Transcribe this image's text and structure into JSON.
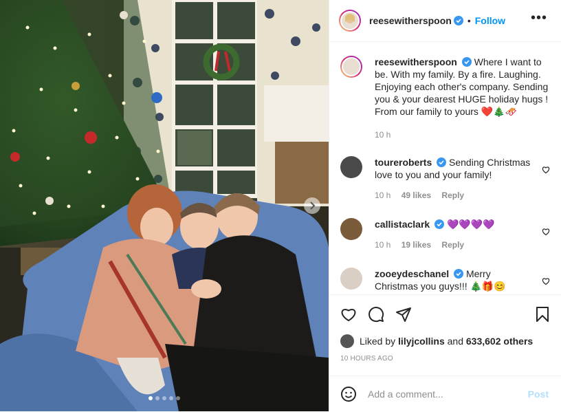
{
  "post": {
    "username": "reesewitherspoon",
    "follow_label": "Follow",
    "separator": "•",
    "more_label": "•••",
    "caption": "Where I want to be. With my family. By a fire. Laughing. Enjoying each other's company. Sending you & your dearest HUGE holiday hugs ! From our family to yours ❤️🎄🛷",
    "caption_time": "10 h"
  },
  "comments": [
    {
      "username": "toureroberts",
      "text": "Sending Christmas love to you and your family!",
      "time": "10 h",
      "likes": "49 likes",
      "reply": "Reply"
    },
    {
      "username": "callistaclark",
      "text": "💜💜💜💜",
      "time": "10 h",
      "likes": "19 likes",
      "reply": "Reply"
    },
    {
      "username": "zooeydeschanel",
      "text": "Merry Christmas you guys!!! 🎄🎁😊"
    }
  ],
  "likes": {
    "prefix": "Liked by",
    "user": "lilyjcollins",
    "connector": "and",
    "count": "633,602 others"
  },
  "timestamp": "10 HOURS AGO",
  "add_comment": {
    "placeholder": "Add a comment...",
    "post_label": "Post"
  },
  "carousel": {
    "total": 5,
    "current": 1
  },
  "colors": {
    "accent": "#0095f6",
    "text": "#262626",
    "muted": "#8e8e8e",
    "post_disabled": "#b2dffc"
  },
  "icons": [
    "verified-badge-icon",
    "more-options-icon",
    "heart-icon",
    "comment-icon",
    "share-icon",
    "bookmark-icon",
    "emoji-icon",
    "chevron-right-icon"
  ]
}
